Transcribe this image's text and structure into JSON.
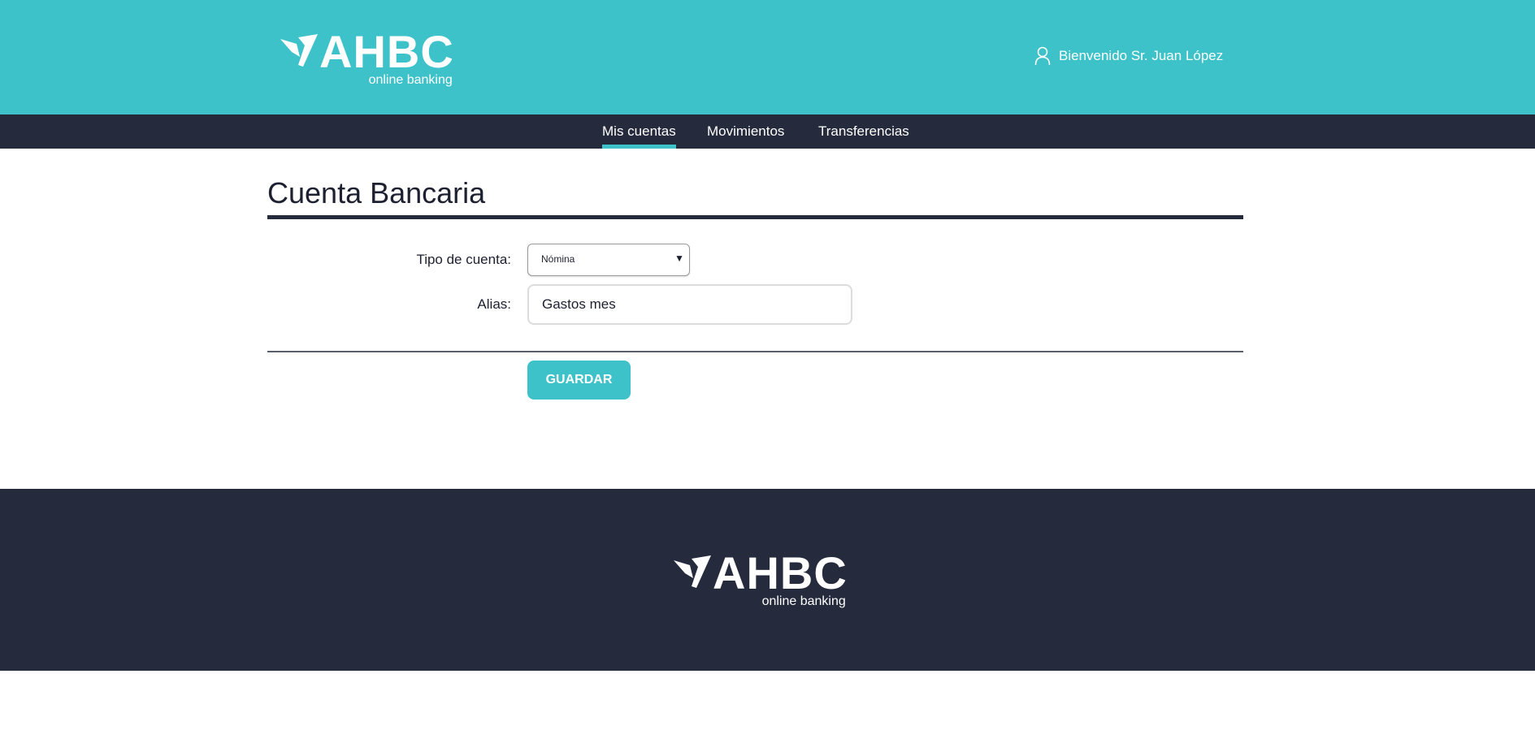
{
  "header": {
    "logo": {
      "brand": "AHBC",
      "tagline": "online banking"
    },
    "welcome_text": "Bienvenido Sr. Juan López",
    "user_icon": "user-icon"
  },
  "nav": {
    "items": [
      {
        "label": "Mis cuentas",
        "active": true
      },
      {
        "label": "Movimientos",
        "active": false
      },
      {
        "label": "Transferencias",
        "active": false
      }
    ]
  },
  "main": {
    "title": "Cuenta Bancaria",
    "form": {
      "account_type_label": "Tipo de cuenta:",
      "account_type_value": "Nómina",
      "alias_label": "Alias:",
      "alias_value": "Gastos mes",
      "save_label": "GUARDAR"
    }
  },
  "footer": {
    "logo": {
      "brand": "AHBC",
      "tagline": "online banking"
    }
  },
  "colors": {
    "accent": "#3dc2c9",
    "dark": "#252a3c",
    "background": "#ffffff"
  }
}
